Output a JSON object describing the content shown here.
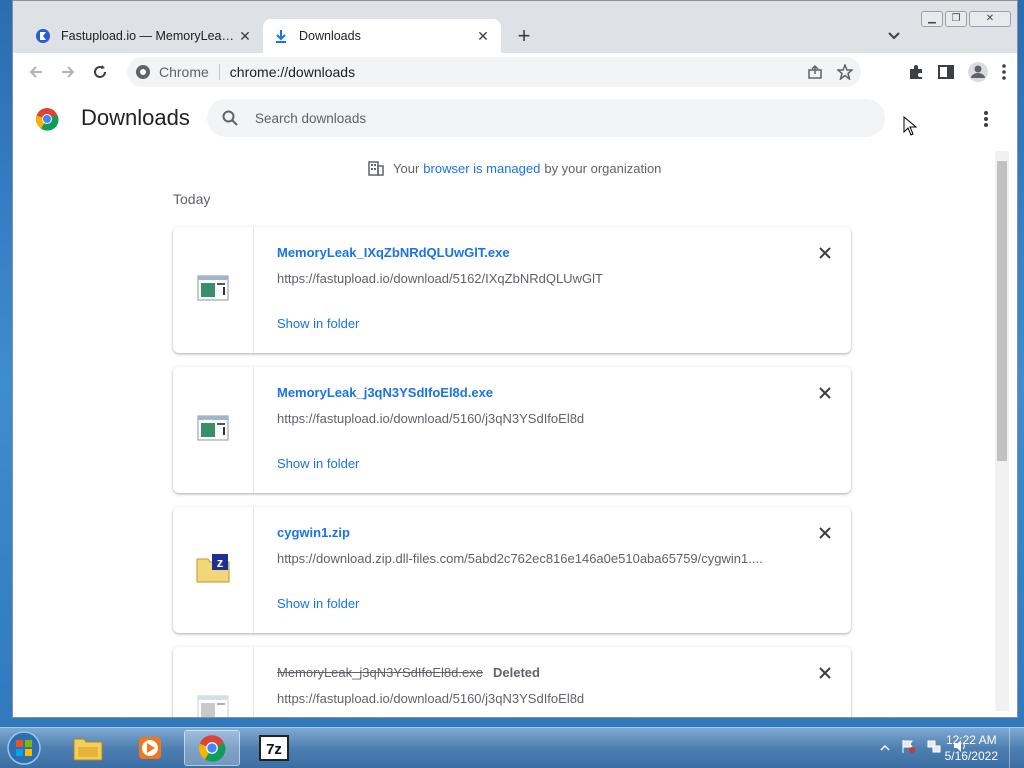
{
  "browser": {
    "tabs": [
      {
        "title": "Fastupload.io — MemoryLeak.exe",
        "active": false
      },
      {
        "title": "Downloads",
        "active": true
      }
    ],
    "omnibox": {
      "chip": "Chrome",
      "url": "chrome://downloads"
    }
  },
  "page": {
    "title": "Downloads",
    "search_placeholder": "Search downloads",
    "managed": {
      "prefix": "Your",
      "link": "browser is managed",
      "suffix": "by your organization"
    },
    "section": "Today",
    "downloads": [
      {
        "name": "MemoryLeak_IXqZbNRdQLUwGlT.exe",
        "url": "https://fastupload.io/download/5162/IXqZbNRdQLUwGlT",
        "action": "Show in folder",
        "icon": "exe-file-icon",
        "status": ""
      },
      {
        "name": "MemoryLeak_j3qN3YSdIfoEl8d.exe",
        "url": "https://fastupload.io/download/5160/j3qN3YSdIfoEl8d",
        "action": "Show in folder",
        "icon": "exe-file-icon",
        "status": ""
      },
      {
        "name": "cygwin1.zip",
        "url": "https://download.zip.dll-files.com/5abd2c762ec816e146a0e510aba65759/cygwin1....",
        "action": "Show in folder",
        "icon": "zip-file-icon",
        "status": ""
      },
      {
        "name": "MemoryLeak_j3qN3YSdIfoEl8d.exe",
        "url": "https://fastupload.io/download/5160/j3qN3YSdIfoEl8d",
        "action": "",
        "icon": "exe-file-icon",
        "status": "Deleted"
      }
    ]
  },
  "taskbar": {
    "time": "12:22 AM",
    "date": "5/16/2022"
  },
  "colors": {
    "accent": "#1a73e8",
    "taskbar": "#4f7fb1"
  }
}
